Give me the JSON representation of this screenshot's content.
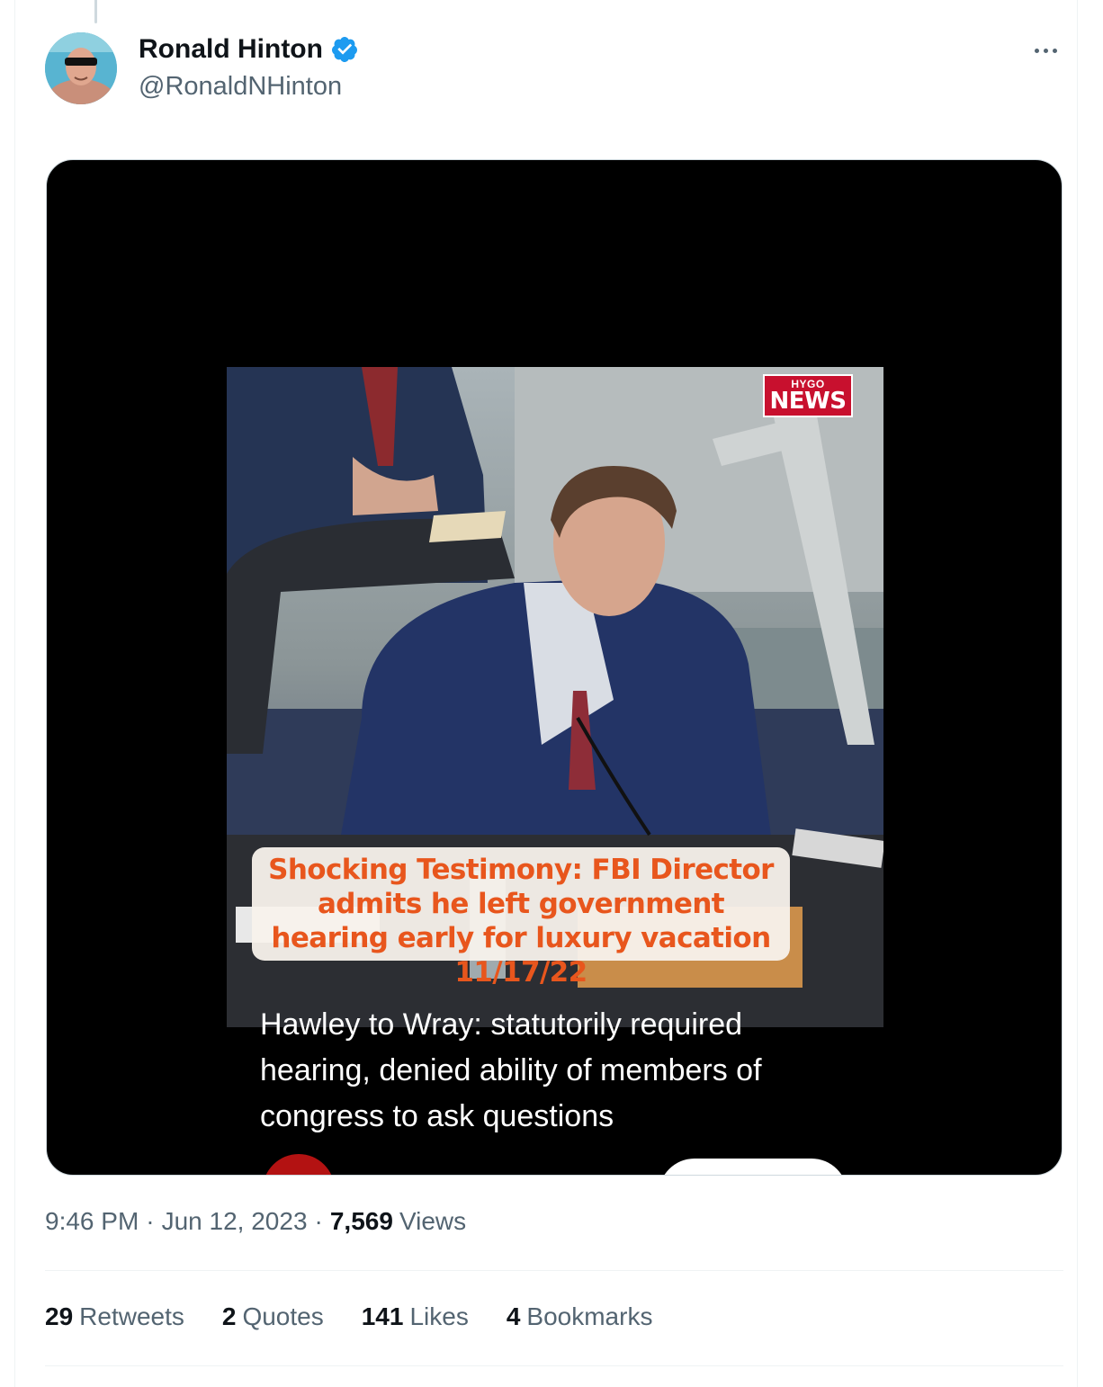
{
  "author": {
    "name": "Ronald Hinton",
    "handle": "@RonaldNHinton",
    "verified": true,
    "verified_color": "#1d9bf0"
  },
  "media": {
    "logo": {
      "top": "HYGO",
      "bottom": "NEWS"
    },
    "headline": "Shocking Testimony: FBI Director admits he left government hearing early for luxury vacation 11/17/22",
    "caption": "Hawley to Wray: statutorily required hearing, denied ability of members of congress to ask questions"
  },
  "meta": {
    "time": "9:46 PM",
    "date": "Jun 12, 2023",
    "views_count": "7,569",
    "views_label": "Views"
  },
  "stats": [
    {
      "count": "29",
      "label": "Retweets"
    },
    {
      "count": "2",
      "label": "Quotes"
    },
    {
      "count": "141",
      "label": "Likes"
    },
    {
      "count": "4",
      "label": "Bookmarks"
    }
  ],
  "icons": {
    "more": "more-icon",
    "verified": "verified-badge-icon"
  },
  "colors": {
    "text_primary": "#0f1419",
    "text_secondary": "#536471",
    "headline_orange": "#e8561d",
    "logo_red": "#c8102e"
  }
}
